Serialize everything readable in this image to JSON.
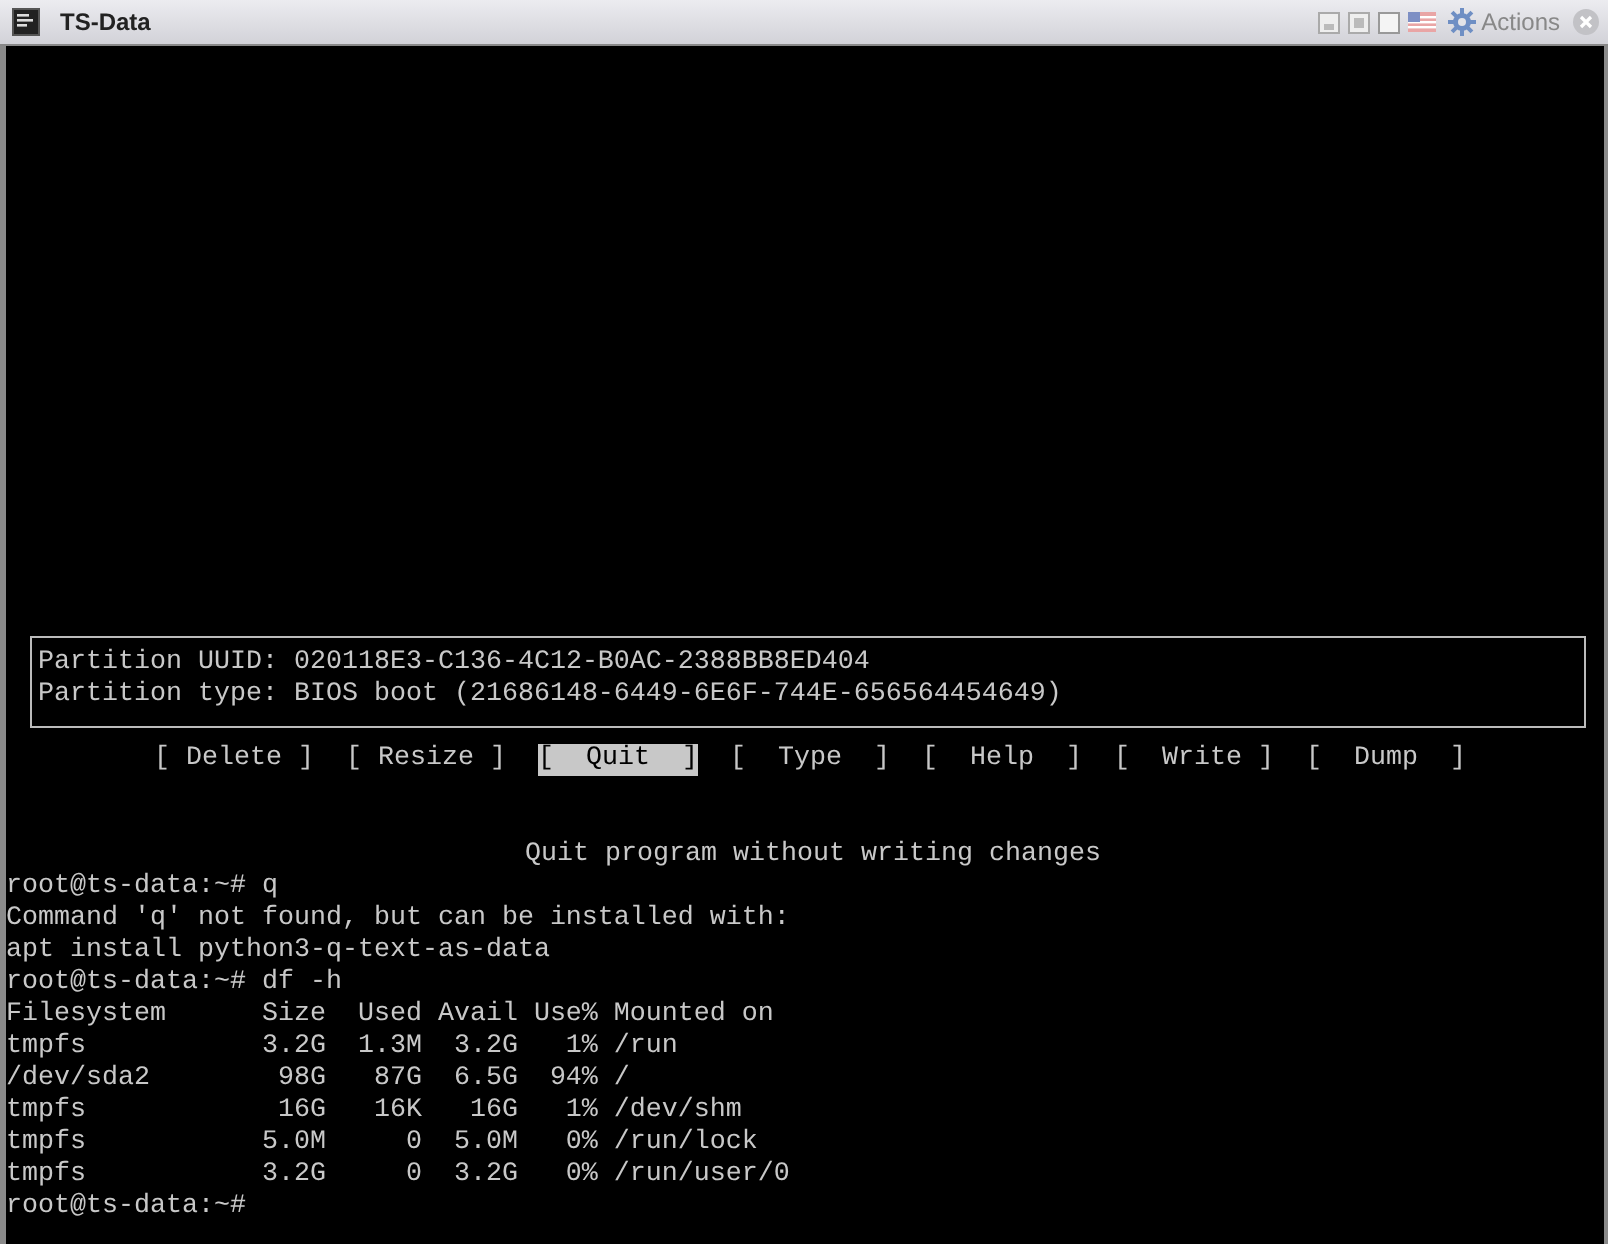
{
  "window": {
    "title": "TS-Data",
    "actions_label": "Actions"
  },
  "partition_info": [
    "Partition UUID: 020118E3-C136-4C12-B0AC-2388BB8ED404",
    "Partition type: BIOS boot (21686148-6449-6E6F-744E-656564454649)"
  ],
  "menu": [
    {
      "label": "[ Delete ]",
      "selected": false
    },
    {
      "label": "[ Resize ]",
      "selected": false
    },
    {
      "label": "[  Quit  ]",
      "selected": true
    },
    {
      "label": "[  Type  ]",
      "selected": false
    },
    {
      "label": "[  Help  ]",
      "selected": false
    },
    {
      "label": "[  Write ]",
      "selected": false
    },
    {
      "label": "[  Dump  ]",
      "selected": false
    }
  ],
  "hint": "Quit program without writing changes",
  "terminal_lines": [
    "root@ts-data:~# q",
    "Command 'q' not found, but can be installed with:",
    "apt install python3-q-text-as-data",
    "root@ts-data:~# df -h",
    "Filesystem      Size  Used Avail Use% Mounted on",
    "tmpfs           3.2G  1.3M  3.2G   1% /run",
    "/dev/sda2        98G   87G  6.5G  94% /",
    "tmpfs            16G   16K   16G   1% /dev/shm",
    "tmpfs           5.0M     0  5.0M   0% /run/lock",
    "tmpfs           3.2G     0  3.2G   0% /run/user/0",
    "root@ts-data:~#"
  ]
}
